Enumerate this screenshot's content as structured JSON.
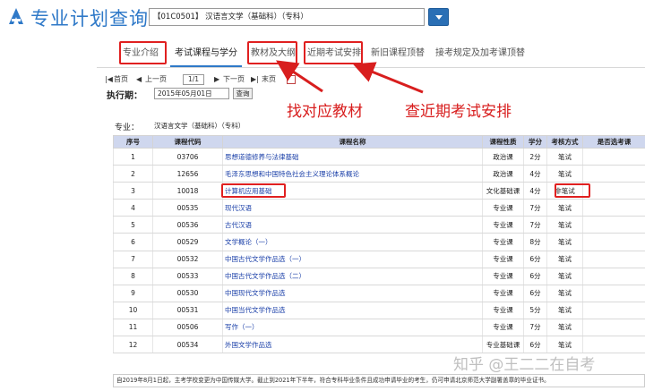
{
  "header": {
    "app_title": "专业计划查询",
    "major_select_value": "【01C0501】 汉语言文学（基础科）（专科）"
  },
  "tabs": [
    {
      "label": "专业介绍"
    },
    {
      "label": "考试课程与学分"
    },
    {
      "label": "教材及大纲"
    },
    {
      "label": "近期考试安排"
    },
    {
      "label": "新旧课程顶替"
    },
    {
      "label": "接考规定及加考课顶替"
    }
  ],
  "pager": {
    "first": "首页",
    "prev": "上一页",
    "page_value": "1/1",
    "next": "下一页",
    "last": "末页",
    "export_icon": "export-icon"
  },
  "exec": {
    "label": "执行期：",
    "date_value": "2015年05月01日",
    "query_label": "查询"
  },
  "annotations": {
    "find_textbook": "找对应教材",
    "check_exam": "查近期考试安排"
  },
  "major_info": {
    "label": "专业：",
    "value": "汉语言文学（基础科）（专科）"
  },
  "table": {
    "headers": [
      "序号",
      "课程代码",
      "课程名称",
      "课程性质",
      "学分",
      "考核方式",
      "是否选考课"
    ],
    "rows": [
      {
        "no": "1",
        "code": "03706",
        "name": "思想道德修养与法律基础",
        "type": "政治课",
        "credit": "2分",
        "exam": "笔试"
      },
      {
        "no": "2",
        "code": "12656",
        "name": "毛泽东思想和中国特色社会主义理论体系概论",
        "type": "政治课",
        "credit": "4分",
        "exam": "笔试"
      },
      {
        "no": "3",
        "code": "10018",
        "name": "计算机应用基础",
        "type": "文化基础课",
        "credit": "4分",
        "exam": "非笔试"
      },
      {
        "no": "4",
        "code": "00535",
        "name": "现代汉语",
        "type": "专业课",
        "credit": "7分",
        "exam": "笔试"
      },
      {
        "no": "5",
        "code": "00536",
        "name": "古代汉语",
        "type": "专业课",
        "credit": "7分",
        "exam": "笔试"
      },
      {
        "no": "6",
        "code": "00529",
        "name": "文学概论（一）",
        "type": "专业课",
        "credit": "8分",
        "exam": "笔试"
      },
      {
        "no": "7",
        "code": "00532",
        "name": "中国古代文学作品选（一）",
        "type": "专业课",
        "credit": "6分",
        "exam": "笔试"
      },
      {
        "no": "8",
        "code": "00533",
        "name": "中国古代文学作品选（二）",
        "type": "专业课",
        "credit": "6分",
        "exam": "笔试"
      },
      {
        "no": "9",
        "code": "00530",
        "name": "中国现代文学作品选",
        "type": "专业课",
        "credit": "6分",
        "exam": "笔试"
      },
      {
        "no": "10",
        "code": "00531",
        "name": "中国当代文学作品选",
        "type": "专业课",
        "credit": "5分",
        "exam": "笔试"
      },
      {
        "no": "11",
        "code": "00506",
        "name": "写作（一）",
        "type": "专业课",
        "credit": "7分",
        "exam": "笔试"
      },
      {
        "no": "12",
        "code": "00534",
        "name": "外国文学作品选",
        "type": "专业基础课",
        "credit": "6分",
        "exam": "笔试"
      }
    ]
  },
  "footer_note": "自2019年8月1日起，主考学校变更为中国传媒大学。截止到2021年下半年，符合专科毕业条件且成功申请毕业的考生，仍可申请北京师范大学副署盖章的毕业证书。",
  "watermark": "知乎 @王二二在自考",
  "colors": {
    "brand": "#2f79c8",
    "annotation_red": "#d81e1e",
    "table_header_bg": "#cfd7ee",
    "link_blue": "#1a3fa8"
  }
}
